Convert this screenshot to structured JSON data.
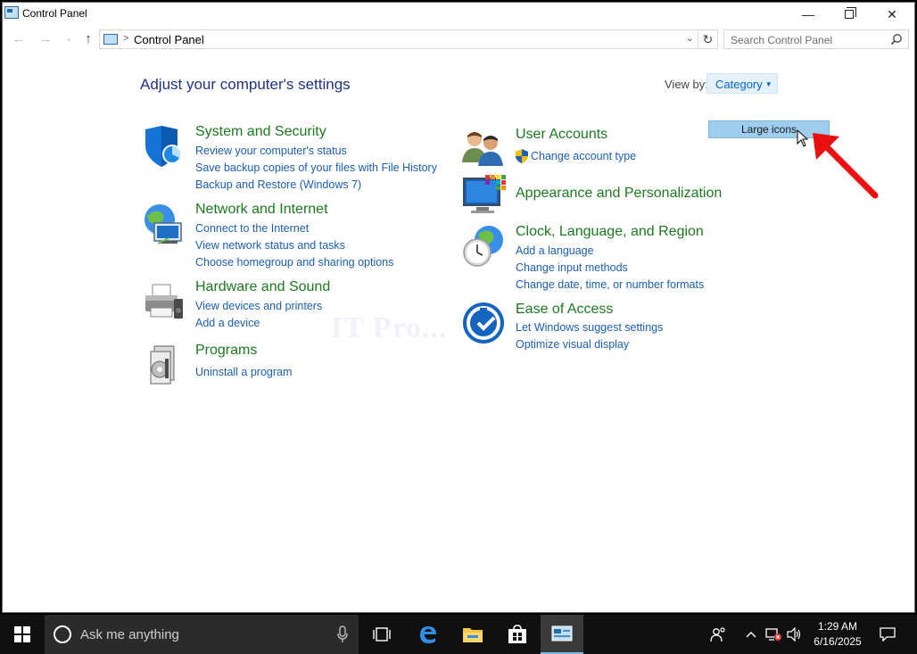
{
  "window": {
    "title": "Control Panel",
    "controls": {
      "minimize": "—",
      "close": "✕"
    }
  },
  "nav": {
    "back": "←",
    "forward": "→",
    "recent": "⌄",
    "up": "↑",
    "breadcrumb_sep": ">",
    "address": "Control Panel",
    "dropdown": "⌄",
    "refresh": "↻",
    "search_placeholder": "Search Control Panel"
  },
  "content": {
    "heading": "Adjust your computer's settings",
    "view_by_label": "View by:",
    "view_by_value": "Category",
    "view_by_caret": "▼",
    "dropdown_option": "Large icons",
    "watermark": "IT Pro..."
  },
  "groups": [
    {
      "title": "System and Security",
      "icon": "shield-icon",
      "links": [
        "Review your computer's status",
        "Save backup copies of your files with File History",
        "Backup and Restore (Windows 7)"
      ]
    },
    {
      "title": "Network and Internet",
      "icon": "globe-network-icon",
      "links": [
        "Connect to the Internet",
        "View network status and tasks",
        "Choose homegroup and sharing options"
      ]
    },
    {
      "title": "Hardware and Sound",
      "icon": "printer-icon",
      "links": [
        "View devices and printers",
        "Add a device"
      ]
    },
    {
      "title": "Programs",
      "icon": "programs-icon",
      "links": [
        "Uninstall a program"
      ]
    },
    {
      "title": "User Accounts",
      "icon": "users-icon",
      "links": [
        "Change account type"
      ]
    },
    {
      "title": "Appearance and Personalization",
      "icon": "monitor-icon",
      "links": []
    },
    {
      "title": "Clock, Language, and Region",
      "icon": "clock-globe-icon",
      "links": [
        "Add a language",
        "Change input methods",
        "Change date, time, or number formats"
      ]
    },
    {
      "title": "Ease of Access",
      "icon": "ease-of-access-icon",
      "links": [
        "Let Windows suggest settings",
        "Optimize visual display"
      ]
    }
  ],
  "taskbar": {
    "search_placeholder": "Ask me anything",
    "time": "1:29 AM",
    "date": "6/16/2025"
  },
  "colors": {
    "heading": "#1e3287",
    "group_title": "#1b7a1e",
    "link": "#1a5fb4",
    "dropdown_highlight": "#9fcdee",
    "taskbar": "#101010",
    "annotation_arrow": "#e81010"
  }
}
